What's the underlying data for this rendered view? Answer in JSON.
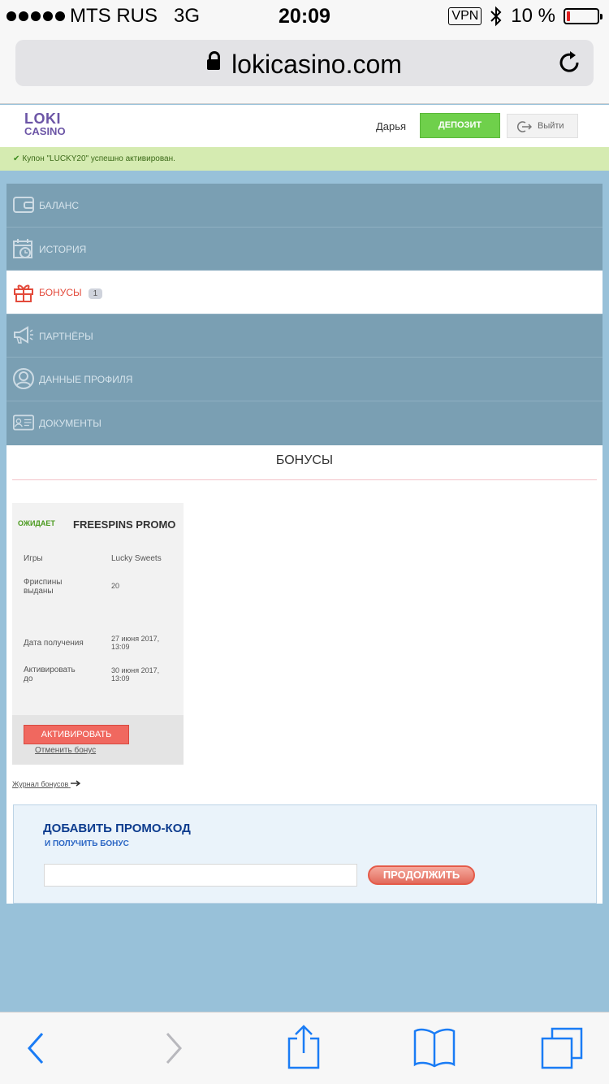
{
  "status_bar": {
    "carrier": "MTS RUS",
    "network": "3G",
    "time": "20:09",
    "vpn": "VPN",
    "battery": "10 %",
    "battery_level": 0.1
  },
  "browser": {
    "url": "lokicasino.com"
  },
  "site_header": {
    "logo_line1": "LOKI",
    "logo_line2": "CASINO",
    "username": "Дарья",
    "deposit_label": "ДЕПОЗИТ",
    "logout_label": "Выйти"
  },
  "notice": {
    "text": "Купон \"LUCKY20\" успешно активирован."
  },
  "menu": {
    "items": [
      {
        "label": "БАЛАНС",
        "icon": "wallet-icon"
      },
      {
        "label": "ИСТОРИЯ",
        "icon": "calendar-clock-icon"
      },
      {
        "label": "БОНУСЫ",
        "icon": "gift-icon",
        "badge": "1"
      },
      {
        "label": "ПАРТНЁРЫ",
        "icon": "megaphone-icon"
      },
      {
        "label": "ДАННЫЕ ПРОФИЛЯ",
        "icon": "user-icon"
      },
      {
        "label": "ДОКУМЕНТЫ",
        "icon": "id-card-icon"
      }
    ]
  },
  "bonuses": {
    "title": "БОНУСЫ",
    "card": {
      "status": "ОЖИДАЕТ",
      "name": "FREESPINS PROMO",
      "games_label": "Игры",
      "games_value": "Lucky Sweets",
      "spins_label_1": "Фриспины",
      "spins_label_2": "выданы",
      "spins_value": "20",
      "received_label": "Дата получения",
      "received_value_1": "27 июня 2017,",
      "received_value_2": "13:09",
      "activate_label_1": "Активировать",
      "activate_label_2": "до",
      "activate_value_1": "30 июня 2017,",
      "activate_value_2": "13:09",
      "activate_button": "АКТИВИРОВАТЬ",
      "cancel_link": "Отменить бонус"
    },
    "journal_link": "Журнал бонусов"
  },
  "promo": {
    "title": "ДОБАВИТЬ ПРОМО-КОД",
    "subtitle": "И ПОЛУЧИТЬ БОНУС",
    "input_value": "",
    "submit_label": "ПРОДОЛЖИТЬ"
  },
  "colors": {
    "accent_green": "#6fd04b",
    "menu_bg": "#7a9fb3",
    "active_red": "#e34a3b",
    "ios_blue": "#1a7cf5"
  }
}
